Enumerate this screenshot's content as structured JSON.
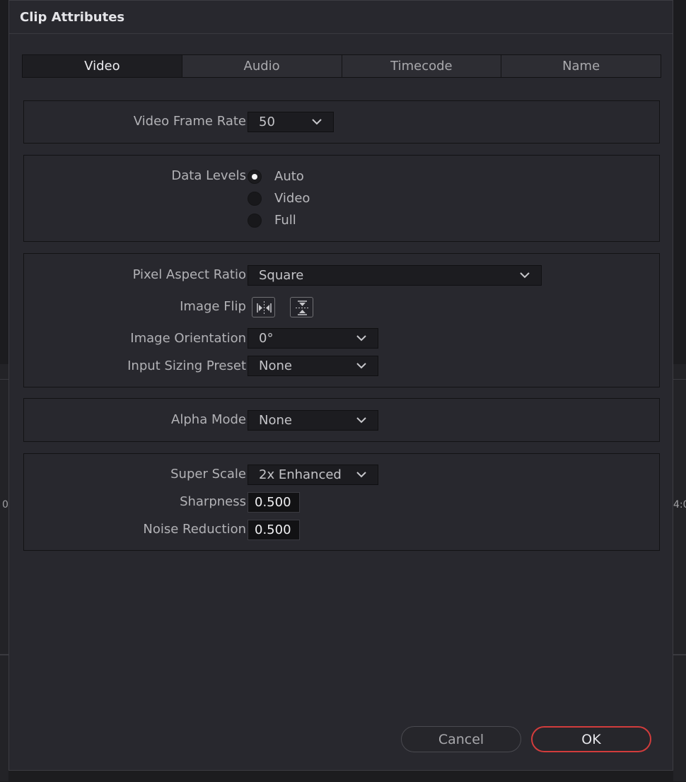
{
  "dialog": {
    "title": "Clip Attributes",
    "tabs": [
      {
        "label": "Video",
        "active": true
      },
      {
        "label": "Audio",
        "active": false
      },
      {
        "label": "Timecode",
        "active": false
      },
      {
        "label": "Name",
        "active": false
      }
    ]
  },
  "video": {
    "frame_rate": {
      "label": "Video Frame Rate",
      "value": "50"
    },
    "data_levels": {
      "label": "Data Levels",
      "options": [
        "Auto",
        "Video",
        "Full"
      ],
      "selected": "Auto"
    },
    "pixel_aspect_ratio": {
      "label": "Pixel Aspect Ratio",
      "value": "Square"
    },
    "image_flip": {
      "label": "Image Flip"
    },
    "image_orientation": {
      "label": "Image Orientation",
      "value": "0°"
    },
    "input_sizing_preset": {
      "label": "Input Sizing Preset",
      "value": "None"
    },
    "alpha_mode": {
      "label": "Alpha Mode",
      "value": "None"
    },
    "super_scale": {
      "label": "Super Scale",
      "value": "2x Enhanced"
    },
    "sharpness": {
      "label": "Sharpness",
      "value": "0.500"
    },
    "noise_reduction": {
      "label": "Noise Reduction",
      "value": "0.500"
    }
  },
  "buttons": {
    "cancel": "Cancel",
    "ok": "OK"
  },
  "background": {
    "left_glyph": "0",
    "right_glyph": "4:0"
  },
  "colors": {
    "accent_ok_border": "#d23c3c",
    "dialog_bg": "#28282e"
  }
}
